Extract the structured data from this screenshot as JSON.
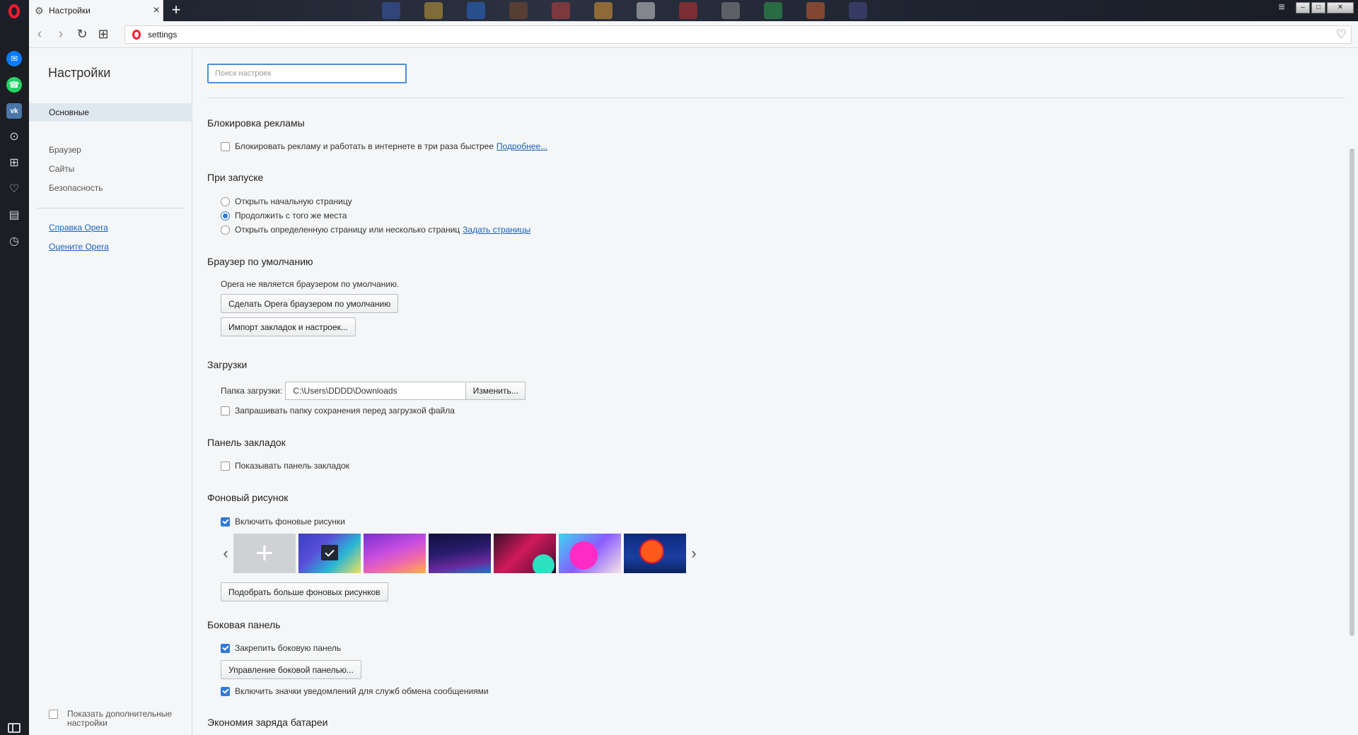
{
  "tab": {
    "title": "Настройки",
    "close": "×",
    "new_tab": "+"
  },
  "window": {
    "menu_icon": "≡",
    "minimize": "–",
    "maximize": "□",
    "close": "✕"
  },
  "address": {
    "url": "settings",
    "back": "‹",
    "forward": "›",
    "reload": "↻",
    "tabs": "⊞",
    "bookmark": "♡"
  },
  "speedbar": {
    "items": [
      {
        "name": "messenger",
        "glyph": "✉"
      },
      {
        "name": "whatsapp",
        "glyph": "☎"
      },
      {
        "name": "vk",
        "glyph": "vk"
      },
      {
        "name": "snapshot",
        "glyph": "⊙"
      },
      {
        "name": "speed-dial",
        "glyph": "⊞"
      },
      {
        "name": "bookmarks",
        "glyph": "♡"
      },
      {
        "name": "news",
        "glyph": "▤"
      },
      {
        "name": "history",
        "glyph": "◷"
      }
    ]
  },
  "nav": {
    "title": "Настройки",
    "items": [
      "Основные",
      "Браузер",
      "Сайты",
      "Безопасность"
    ],
    "links": [
      "Справка Opera",
      "Оцените Opera"
    ],
    "advanced_label": "Показать дополнительные настройки"
  },
  "search": {
    "placeholder": "Поиск настроек"
  },
  "sections": {
    "adblock": {
      "title": "Блокировка рекламы",
      "option": "Блокировать рекламу и работать в интернете в три раза быстрее",
      "more_link": "Подробнее...",
      "checked": false
    },
    "startup": {
      "title": "При запуске",
      "options": [
        {
          "label": "Открыть начальную страницу",
          "checked": false
        },
        {
          "label": "Продолжить с того же места",
          "checked": true
        },
        {
          "label": "Открыть определенную страницу или несколько страниц",
          "checked": false
        }
      ],
      "set_pages_link": "Задать страницы"
    },
    "default_browser": {
      "title": "Браузер по умолчанию",
      "status": "Opera не является браузером по умолчанию.",
      "make_default_button": "Сделать Opera браузером по умолчанию",
      "import_button": "Импорт закладок и настроек..."
    },
    "downloads": {
      "title": "Загрузки",
      "folder_label": "Папка загрузки:",
      "folder_path": "C:\\Users\\DDDD\\Downloads",
      "change_button": "Изменить...",
      "ask_option": "Запрашивать папку сохранения перед загрузкой файла",
      "ask_checked": false
    },
    "bookmarks_bar": {
      "title": "Панель закладок",
      "option": "Показывать панель закладок",
      "checked": false
    },
    "wallpaper": {
      "title": "Фоновый рисунок",
      "option": "Включить фоновые рисунки",
      "checked": true,
      "more_button": "Подобрать больше фоновых рисунков",
      "prev": "‹",
      "next": "›",
      "add": "+"
    },
    "sidebar": {
      "title": "Боковая панель",
      "pin_option": "Закрепить боковую панель",
      "pin_checked": true,
      "manage_button": "Управление боковой панелью...",
      "notif_option": "Включить значки уведомлений для служб обмена сообщениями",
      "notif_checked": true
    },
    "battery": {
      "title": "Экономия заряда батареи"
    }
  },
  "colors": {
    "accent": "#2f7ad4",
    "link": "#1a62b5",
    "opera_red": "#ff1b2d"
  }
}
